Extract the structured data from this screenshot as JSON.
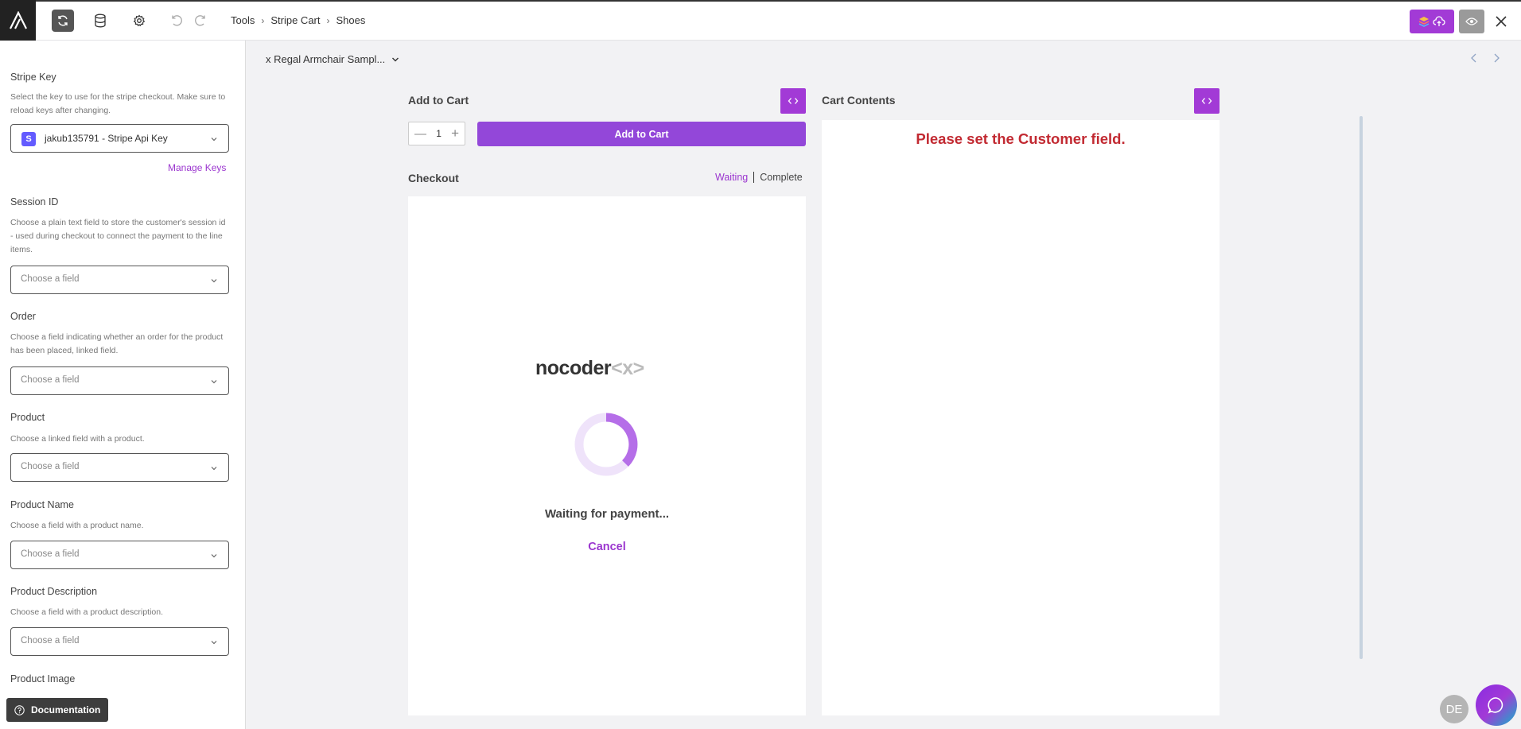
{
  "toolbar": {
    "breadcrumbs": [
      "Tools",
      "Stripe Cart",
      "Shoes"
    ],
    "icons": [
      "app-logo",
      "refresh-icon",
      "database-icon",
      "gear-icon",
      "undo-icon",
      "redo-icon",
      "publish-icon",
      "eye-icon",
      "close-icon"
    ]
  },
  "sidebar": {
    "stripe_key": {
      "label": "Stripe Key",
      "description": "Select the key to use for the stripe checkout. Make sure to reload keys after changing.",
      "value": "jakub135791 - Stripe Api Key",
      "icon_letter": "S",
      "manage_label": "Manage Keys"
    },
    "fields": [
      {
        "label": "Session ID",
        "description": "Choose a plain text field to store the customer's session id - used during checkout to connect the payment to the line items.",
        "placeholder": "Choose a field"
      },
      {
        "label": "Order",
        "description": "Choose a field indicating whether an order for the product has been placed, linked field.",
        "placeholder": "Choose a field"
      },
      {
        "label": "Product",
        "description": "Choose a linked field with a product.",
        "placeholder": "Choose a field"
      },
      {
        "label": "Product Name",
        "description": "Choose a field with a product name.",
        "placeholder": "Choose a field"
      },
      {
        "label": "Product Description",
        "description": "Choose a field with a product description.",
        "placeholder": "Choose a field"
      },
      {
        "label": "Product Image"
      }
    ],
    "documentation_label": "Documentation"
  },
  "main": {
    "record_selector": "x Regal Armchair Sampl...",
    "add_to_cart": {
      "title": "Add to Cart",
      "quantity": "1",
      "button_label": "Add to Cart"
    },
    "checkout": {
      "title": "Checkout",
      "tabs": [
        "Waiting",
        "Complete"
      ],
      "active_tab": "Waiting",
      "brand": "nocoder",
      "brand_mark": "<x>",
      "status_text": "Waiting for payment...",
      "cancel_label": "Cancel"
    },
    "cart": {
      "title": "Cart Contents",
      "message": "Please set the Customer field."
    }
  },
  "user": {
    "initials": "DE"
  },
  "colors": {
    "accent": "#a23ad6",
    "error": "#c22a32",
    "dark": "#222222"
  }
}
